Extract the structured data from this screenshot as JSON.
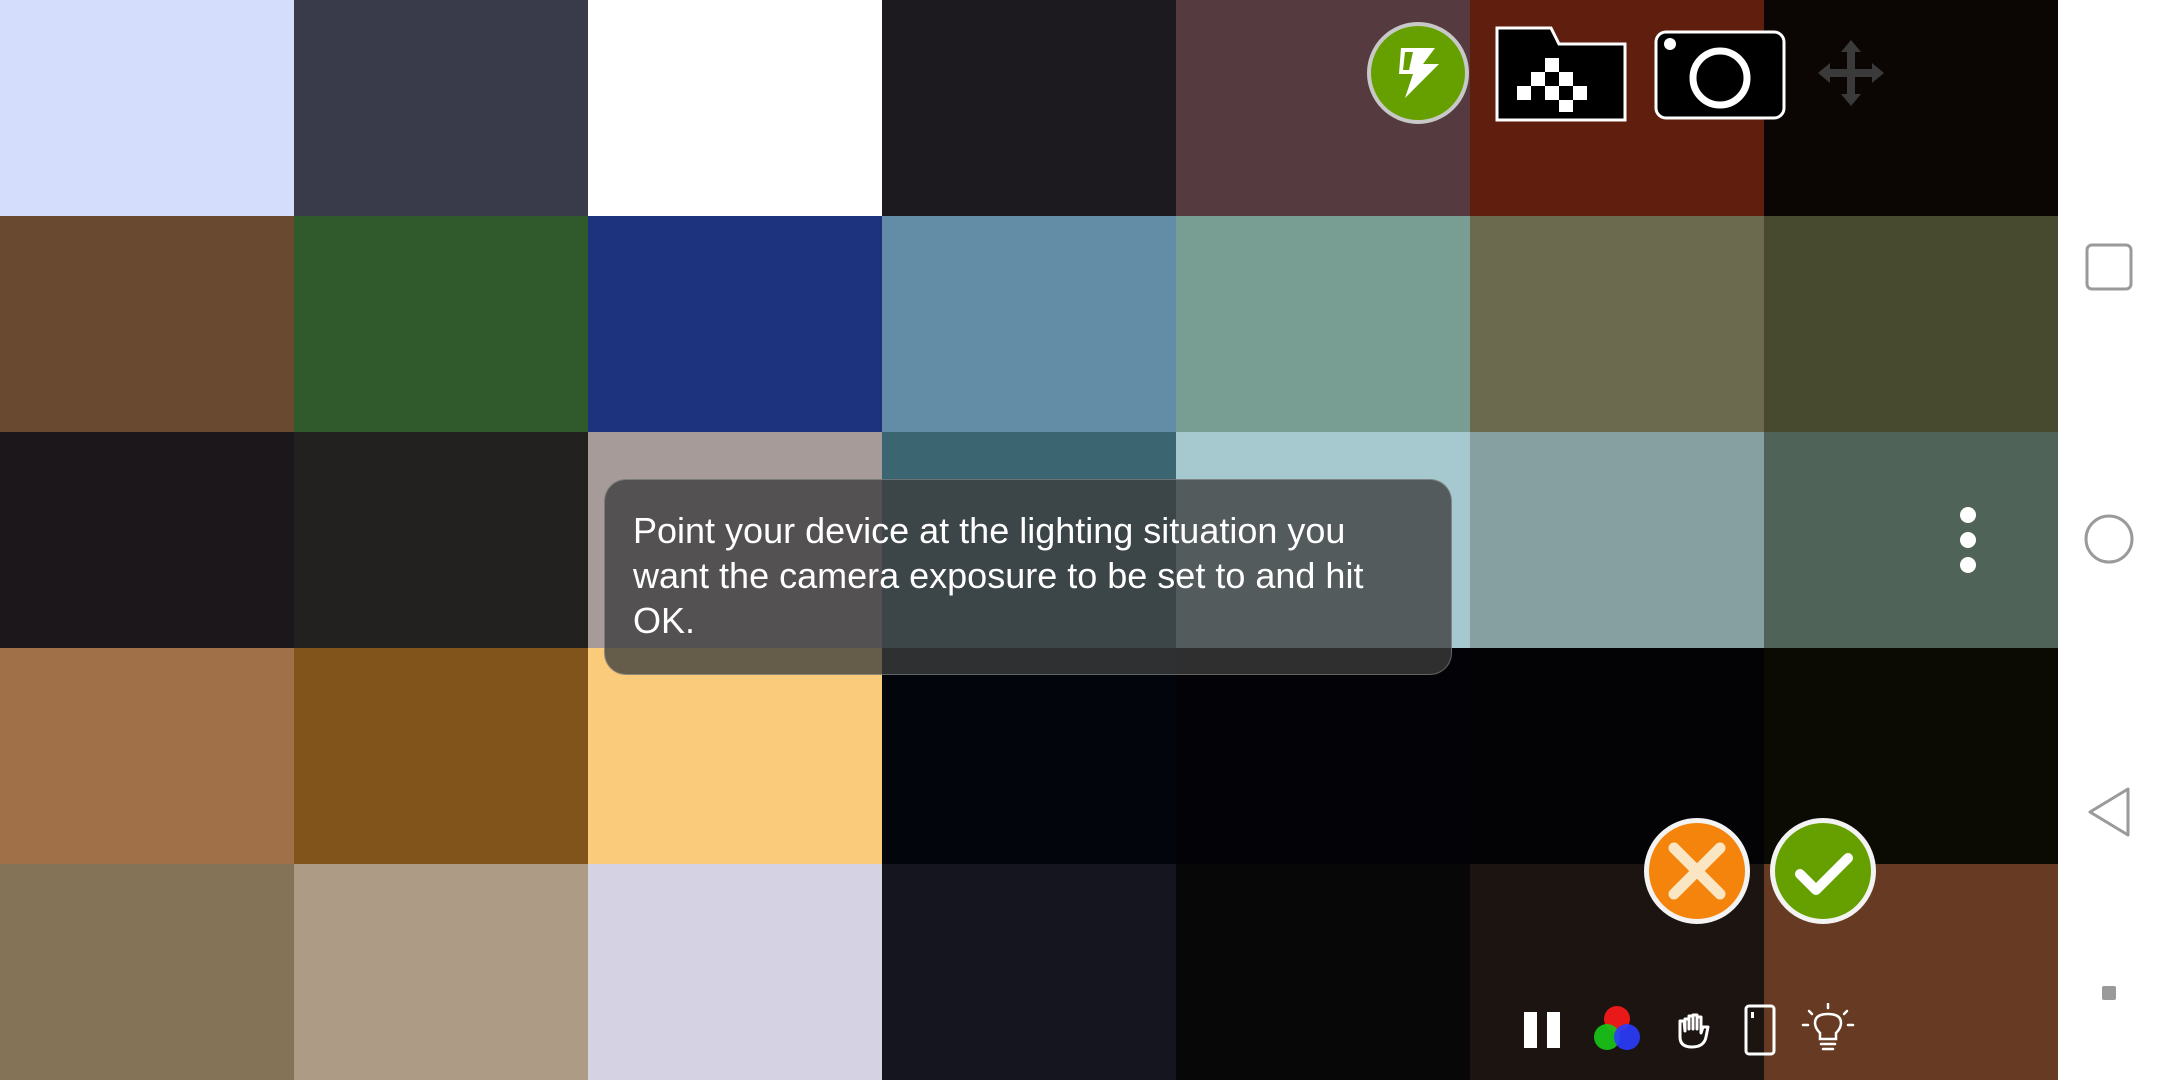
{
  "swatches": [
    [
      "#d5ddfd",
      "#393a4a",
      "#ffffff",
      "#1c1a1e",
      "#553b40",
      "#601e0e",
      "#0b0604"
    ],
    [
      "#69492f",
      "#305a2c",
      "#1e337e",
      "#638ca7",
      "#789e93",
      "#6b6a4e",
      "#474a2f"
    ],
    [
      "#1c171b",
      "#222120",
      "#a69b99",
      "#3b6571",
      "#a6c9d0",
      "#869fa1",
      "#4f6359"
    ],
    [
      "#a07148",
      "#80541a",
      "#fbcb7c",
      "#02050c",
      "#030307",
      "#030305",
      "#0c0b03"
    ],
    [
      "#857358",
      "#ad9b86",
      "#d4d2e3",
      "#151520",
      "#070707",
      "#1b1410",
      "#673b23"
    ]
  ],
  "colors": {
    "accent_green": "#66a000",
    "accent_orange": "#f5840c"
  },
  "toast": {
    "message": "Point your device at the lighting situation you want the camera exposure to be set to and hit OK."
  },
  "toolbar": {
    "top": [
      "exposure-lock-icon",
      "folder-icon",
      "camera-icon",
      "move-icon"
    ],
    "bottom": [
      "pause-icon",
      "rgb-color-icon",
      "hand-icon",
      "phone-icon",
      "light-bulb-icon"
    ]
  },
  "dialog": {
    "cancel_icon": "close-icon",
    "ok_icon": "check-icon"
  },
  "system_nav": [
    "recent-apps-icon",
    "home-icon",
    "back-icon",
    "assistant-dot-icon"
  ]
}
